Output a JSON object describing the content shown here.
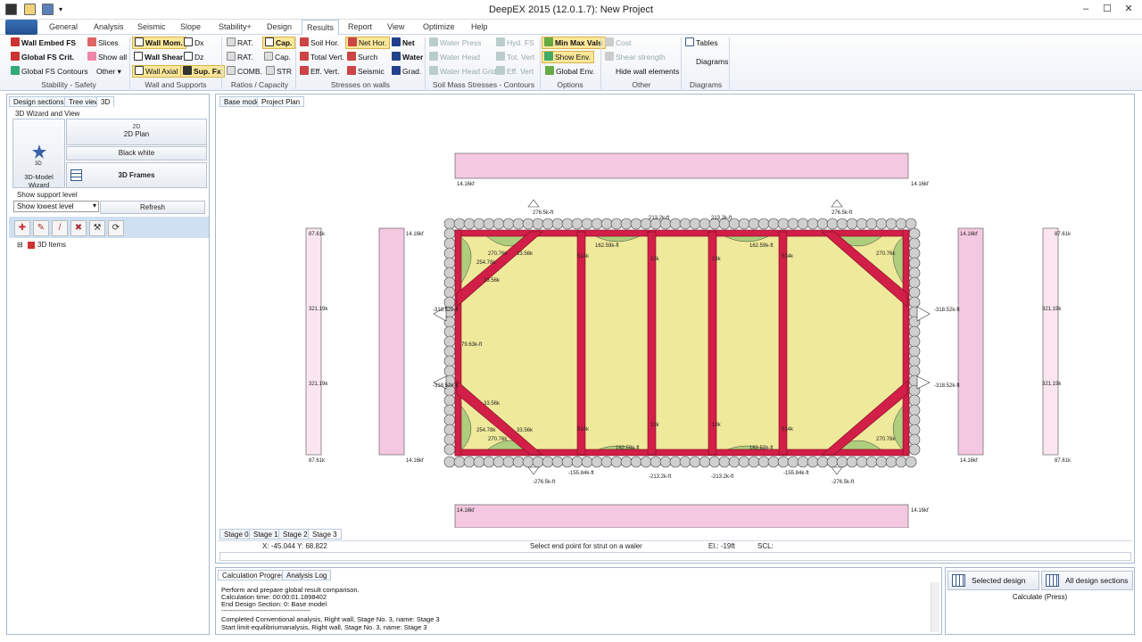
{
  "window": {
    "title": "DeepEX 2015  (12.0.1.7): New Project",
    "minimize": "–",
    "maximize": "☐",
    "close": "✕"
  },
  "menu": {
    "tabs": [
      "General",
      "Analysis",
      "Seismic",
      "Slope",
      "Stability+",
      "Design",
      "Results",
      "Report",
      "View",
      "Optimize",
      "Help"
    ],
    "active": "Results"
  },
  "ribbon": {
    "stability": {
      "b1": "Wall Embed FS",
      "b2": "Global FS Crit.",
      "b3": "Global FS Contours",
      "b4": "Slices",
      "b5": "Show all",
      "b6": "Other",
      "label": "Stability - Safety"
    },
    "wall": {
      "b1": "Wall Mom.",
      "b2": "Dx",
      "b3": "Wall Shear",
      "b4": "Dz",
      "b5": "Wall Axial",
      "b6": "Sup. Fx",
      "label": "Wall and Supports"
    },
    "ratios": {
      "b1": "RAT.",
      "b2": "Cap.",
      "b3": "RAT.",
      "b4": "Cap.",
      "b5": "COMB.",
      "b6": "STR",
      "label": "Ratios / Capacity"
    },
    "stresses": {
      "b1": "Soil Hor.",
      "b2": "Net Hor.",
      "b3": "Net",
      "b4": "Total Vert.",
      "b5": "Surch",
      "b6": "Water",
      "b7": "Eff. Vert.",
      "b8": "Seismic",
      "b9": "Grad.",
      "label": "Stresses on walls"
    },
    "soilmass": {
      "b1": "Water Press",
      "b2": "Hyd. FS",
      "b3": "Water Head",
      "b4": "Tot. Vert",
      "b5": "Water Head Grid",
      "b6": "Eff. Vert",
      "label": "Soil Mass Stresses - Contours"
    },
    "options": {
      "b1": "Min Max Vals",
      "b2": "Show Env.",
      "b3": "Global Env.",
      "label": "Options"
    },
    "other": {
      "b1": "Cost",
      "b2": "Shear strength",
      "b3": "Hide wall elements",
      "label": "Other"
    },
    "diagrams": {
      "b1": "Tables",
      "b2": "Diagrams",
      "label": "Diagrams"
    }
  },
  "left": {
    "tabs": [
      "Design sections",
      "Tree view",
      "3D"
    ],
    "active_tab": "3D",
    "group_title": "3D Wizard and View",
    "wizard_label": "3D-Model Wizard",
    "plan_badge": "2D",
    "plan_btn": "2D Plan",
    "blackwhite_btn": "Black white",
    "frames_btn": "3D Frames",
    "support_label": "Show support level",
    "support_select": "Show lowest level",
    "refresh_btn": "Refresh",
    "tree_root": "3D Items",
    "tree_expand": "⊟"
  },
  "view": {
    "tabs": [
      "Base model",
      "Project Plan"
    ],
    "active_tab": "Project Plan",
    "stage_tabs": [
      "Stage 0",
      "Stage 1",
      "Stage 2",
      "Stage 3"
    ],
    "active_stage": "Stage 3",
    "coords": "X: -45.044   Y: 68.822",
    "status_msg": "Select end point for strut on a waler",
    "elevation": "El.: -19ft",
    "scale": "SCL:"
  },
  "plan": {
    "top_pressure": "14.16kf",
    "side_pressure": "14.16kf",
    "far_side": "87.61k",
    "far_mid": "321.19k",
    "wall_top_corner": "276.5k-ft",
    "wall_bot_corner": "-276.5k-ft",
    "wall_top_mid": "213.2k-ft",
    "wall_bot_mid": "-213.2k-ft",
    "wall_bot_near": "-155.84k-ft",
    "wall_side": "-318.52k-ft",
    "waler_mid": "162.59k-ft",
    "strut_force": "514k",
    "strut_force2": "13k",
    "corner_force": "270.76k",
    "corner_force2": "254.78k",
    "corner_force3": "33.56k",
    "waler_left": "79.63k-ft"
  },
  "bottom": {
    "tabs": [
      "Calculation Progress",
      "Analysis Log"
    ],
    "active_tab": "Calculation Progress",
    "log": [
      "Perform and prepare global result comparison.",
      "Calculation time: 00:00:01.1898402",
      "End Design Section: 0: Base model",
      "----------------------------------------",
      "Completed Conventional analysis, Right wall, Stage No. 3, name: Stage 3",
      "Start limit-equilibriumanalysis, Right wall, Stage No. 3, name: Stage 3"
    ]
  },
  "calc": {
    "selected": "Selected design",
    "all": "All design sections",
    "hint": "Calculate (Press)"
  },
  "colors": {
    "strut": "#d21f47",
    "soil": "#efe99b",
    "pile": "#cfcfcf",
    "pressure": "#f4c8e0",
    "highlight": "#fbe79a"
  }
}
